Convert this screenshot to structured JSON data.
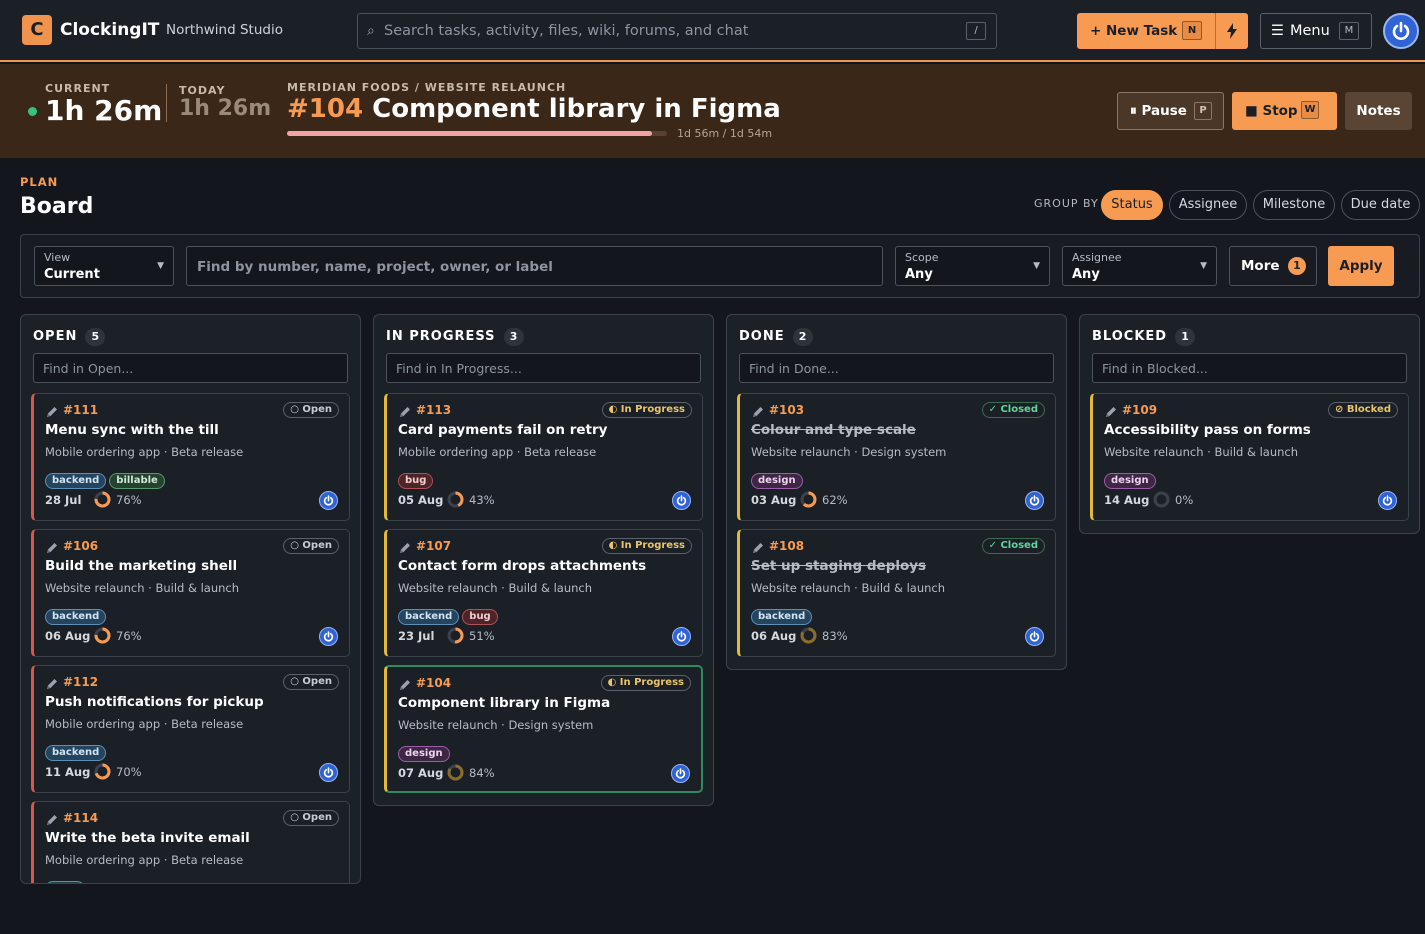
{
  "topbar": {
    "logo_letter": "C",
    "app_name": "ClockingIT",
    "workspace": "Northwind Studio",
    "search_placeholder": "Search tasks, activity, files, wiki, forums, and chat",
    "search_shortcut": "/",
    "new_task_label": "+ New Task",
    "new_task_shortcut": "N",
    "menu_label": "Menu",
    "menu_shortcut": "M"
  },
  "timer": {
    "current_label": "CURRENT",
    "current_value": "1h 26m",
    "today_label": "TODAY",
    "today_value": "1h 26m",
    "project_path": "MERIDIAN FOODS / WEBSITE RELAUNCH",
    "task_number": "#104",
    "task_title": "Component library in Figma",
    "progress": 0.96,
    "progress_text": "1d 56m / 1d 54m",
    "pause_label": "Pause",
    "pause_shortcut": "P",
    "stop_label": "Stop",
    "stop_shortcut": "W",
    "notes_label": "Notes"
  },
  "page": {
    "section": "PLAN",
    "title": "Board",
    "group_by_label": "GROUP BY",
    "group_options": [
      "Status",
      "Assignee",
      "Milestone",
      "Due date"
    ],
    "group_active": "Status"
  },
  "filters": {
    "view_label": "View",
    "view_value": "Current",
    "find_placeholder": "Find by number, name, project, owner, or label",
    "scope_label": "Scope",
    "scope_value": "Any",
    "assignee_label": "Assignee",
    "assignee_value": "Any",
    "more_label": "More",
    "more_count": "1",
    "apply_label": "Apply"
  },
  "columns": [
    {
      "name": "OPEN",
      "count": "5",
      "search_placeholder": "Find in Open...",
      "cards": [
        {
          "num": "#111",
          "status": "○ Open",
          "title": "Menu sync with the till",
          "sub": "Mobile ordering app · Beta release",
          "tags": [
            "backend",
            "billable"
          ],
          "date": "28 Jul",
          "pct": "76%",
          "progress": 0.76
        },
        {
          "num": "#106",
          "status": "○ Open",
          "title": "Build the marketing shell",
          "sub": "Website relaunch · Build & launch",
          "tags": [
            "backend"
          ],
          "date": "06 Aug",
          "pct": "76%",
          "progress": 0.76
        },
        {
          "num": "#112",
          "status": "○ Open",
          "title": "Push notifications for pickup",
          "sub": "Mobile ordering app · Beta release",
          "tags": [
            "backend"
          ],
          "date": "11 Aug",
          "pct": "70%",
          "progress": 0.7
        },
        {
          "num": "#114",
          "status": "○ Open",
          "title": "Write the beta invite email",
          "sub": "Mobile ordering app · Beta release",
          "tags": [
            "copy"
          ],
          "date": "",
          "pct": "",
          "progress": 0
        }
      ]
    },
    {
      "name": "IN PROGRESS",
      "count": "3",
      "search_placeholder": "Find in In Progress...",
      "cards": [
        {
          "num": "#113",
          "status": "◐ In Progress",
          "title": "Card payments fail on retry",
          "sub": "Mobile ordering app · Beta release",
          "tags": [
            "bug"
          ],
          "date": "05 Aug",
          "pct": "43%",
          "progress": 0.43
        },
        {
          "num": "#107",
          "status": "◐ In Progress",
          "title": "Contact form drops attachments",
          "sub": "Website relaunch · Build & launch",
          "tags": [
            "backend",
            "bug"
          ],
          "date": "23 Jul",
          "pct": "51%",
          "progress": 0.51
        },
        {
          "num": "#104",
          "status": "◐ In Progress",
          "title": "Component library in Figma",
          "sub": "Website relaunch · Design system",
          "tags": [
            "design"
          ],
          "date": "07 Aug",
          "pct": "84%",
          "progress": 0.84
        }
      ]
    },
    {
      "name": "DONE",
      "count": "2",
      "search_placeholder": "Find in Done...",
      "cards": [
        {
          "num": "#103",
          "status": "✓ Closed",
          "title": "Colour and type scale",
          "sub": "Website relaunch · Design system",
          "tags": [
            "design"
          ],
          "date": "03 Aug",
          "pct": "62%",
          "progress": 0.62
        },
        {
          "num": "#108",
          "status": "✓ Closed",
          "title": "Set up staging deploys",
          "sub": "Website relaunch · Build & launch",
          "tags": [
            "backend"
          ],
          "date": "06 Aug",
          "pct": "83%",
          "progress": 0.83
        }
      ]
    },
    {
      "name": "BLOCKED",
      "count": "1",
      "search_placeholder": "Find in Blocked...",
      "cards": [
        {
          "num": "#109",
          "status": "⊘ Blocked",
          "title": "Accessibility pass on forms",
          "sub": "Website relaunch · Build & launch",
          "tags": [
            "design"
          ],
          "date": "14 Aug",
          "pct": "0%",
          "progress": 0
        }
      ]
    }
  ],
  "colors": {
    "accent": "#f89b52",
    "open_bar": "#d8564a",
    "progress_bar": "#e3b93b",
    "active_border": "#2f8a5d",
    "closed": "#5fd59a"
  }
}
